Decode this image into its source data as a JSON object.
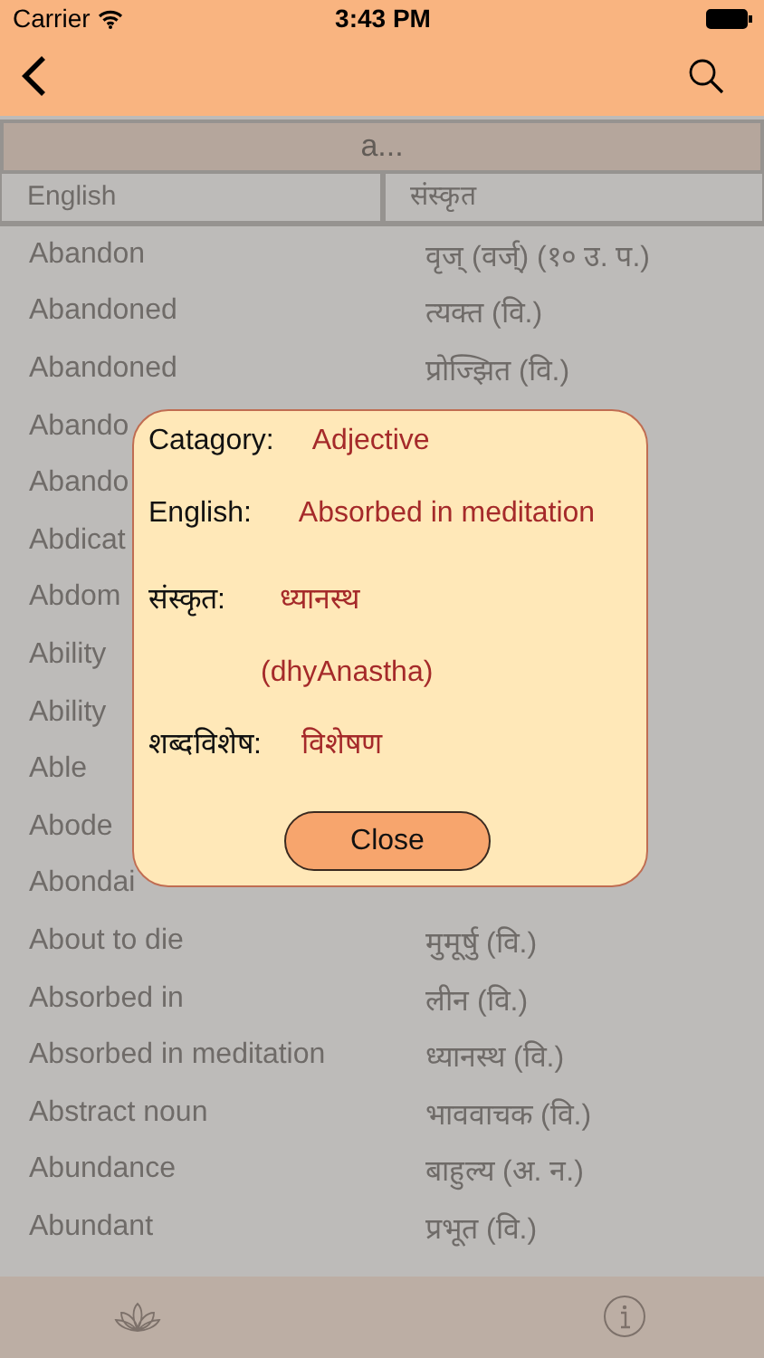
{
  "status_bar": {
    "carrier": "Carrier",
    "time": "3:43 PM"
  },
  "section_header": "a...",
  "columns": [
    "English",
    "संस्कृत"
  ],
  "rows": [
    {
      "english": "Abandon",
      "sanskrit": "वृज् (वर्ज्) (१० उ. प.)"
    },
    {
      "english": "Abandoned",
      "sanskrit": "त्यक्त (वि.)"
    },
    {
      "english": "Abandoned",
      "sanskrit": "प्रोज्झित (वि.)"
    },
    {
      "english": "Abando"
    },
    {
      "english": "Abando"
    },
    {
      "english": "Abdicat"
    },
    {
      "english": "Abdom"
    },
    {
      "english": "Ability"
    },
    {
      "english": "Ability"
    },
    {
      "english": "Able"
    },
    {
      "english": "Abode"
    },
    {
      "english": "Abondai"
    },
    {
      "english": "About to die",
      "sanskrit": "मुमूर्षु (वि.)"
    },
    {
      "english": "Absorbed in",
      "sanskrit": "लीन (वि.)"
    },
    {
      "english": "Absorbed in meditation",
      "sanskrit": "ध्यानस्थ (वि.)"
    },
    {
      "english": "Abstract noun",
      "sanskrit": "भाववाचक (वि.)"
    },
    {
      "english": "Abundance",
      "sanskrit": "बाहुल्य (अ. न.)"
    },
    {
      "english": "Abundant",
      "sanskrit": "प्रभूत (वि.)"
    }
  ],
  "popup": {
    "category_label": "Catagory:",
    "category": "Adjective",
    "english_label": "English:",
    "english": "Absorbed in meditation",
    "sanskrit_label": "संस्कृत:",
    "sanskrit": "ध्यानस्थ",
    "transliteration": "(dhyAnastha)",
    "type_label": "शब्दविशेष:",
    "type": "विशेषण",
    "button": "Close"
  }
}
